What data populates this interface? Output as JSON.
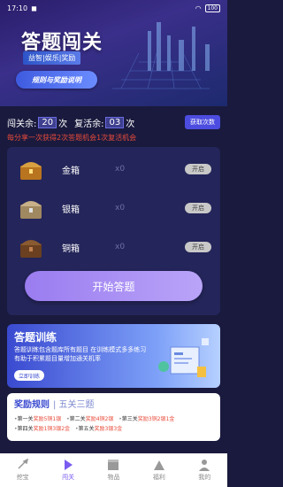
{
  "status": {
    "time": "17:10",
    "battery": "100"
  },
  "hero": {
    "title": "答题闯关",
    "tags": "益智|娱乐|奖励",
    "rules_button": "规则与奖励说明"
  },
  "stats": {
    "levels_label": "闯关余:",
    "levels_value": "20",
    "levels_unit": "次",
    "revive_label": "复活余:",
    "revive_value": "03",
    "revive_unit": "次",
    "get_button": "获取次数",
    "share_note": "每分享一次获得2次答题机会1次复活机会"
  },
  "chests": [
    {
      "name": "金箱",
      "count": "x0",
      "button": "开启",
      "color": "#d8a040"
    },
    {
      "name": "银箱",
      "count": "x0",
      "button": "开启",
      "color": "#c0a070"
    },
    {
      "name": "铜箱",
      "count": "x0",
      "button": "开启",
      "color": "#8a5a30"
    }
  ],
  "start_button": "开始答题",
  "training": {
    "title": "答题训练",
    "desc": "答题训练包含题库所有题目 在训练模式多多练习有助于积累题目量增加通关机率",
    "button": "立即训练"
  },
  "rewards": {
    "title": "奖励规则",
    "subtitle": "| 五关三题",
    "items": [
      {
        "prefix": "第一关",
        "reward": "奖励5铜1银"
      },
      {
        "prefix": "第二关",
        "reward": "奖励4铜2银"
      },
      {
        "prefix": "第三关",
        "reward": "奖励3铜2银1金"
      },
      {
        "prefix": "第四关",
        "reward": "奖励1铜3银2金"
      },
      {
        "prefix": "第五关",
        "reward": "奖励3银3金"
      }
    ]
  },
  "tabs": [
    {
      "label": "挖宝",
      "icon": "shovel-icon"
    },
    {
      "label": "闯关",
      "icon": "play-icon"
    },
    {
      "label": "物品",
      "icon": "box-icon"
    },
    {
      "label": "福利",
      "icon": "gift-icon"
    },
    {
      "label": "我的",
      "icon": "user-icon"
    }
  ]
}
